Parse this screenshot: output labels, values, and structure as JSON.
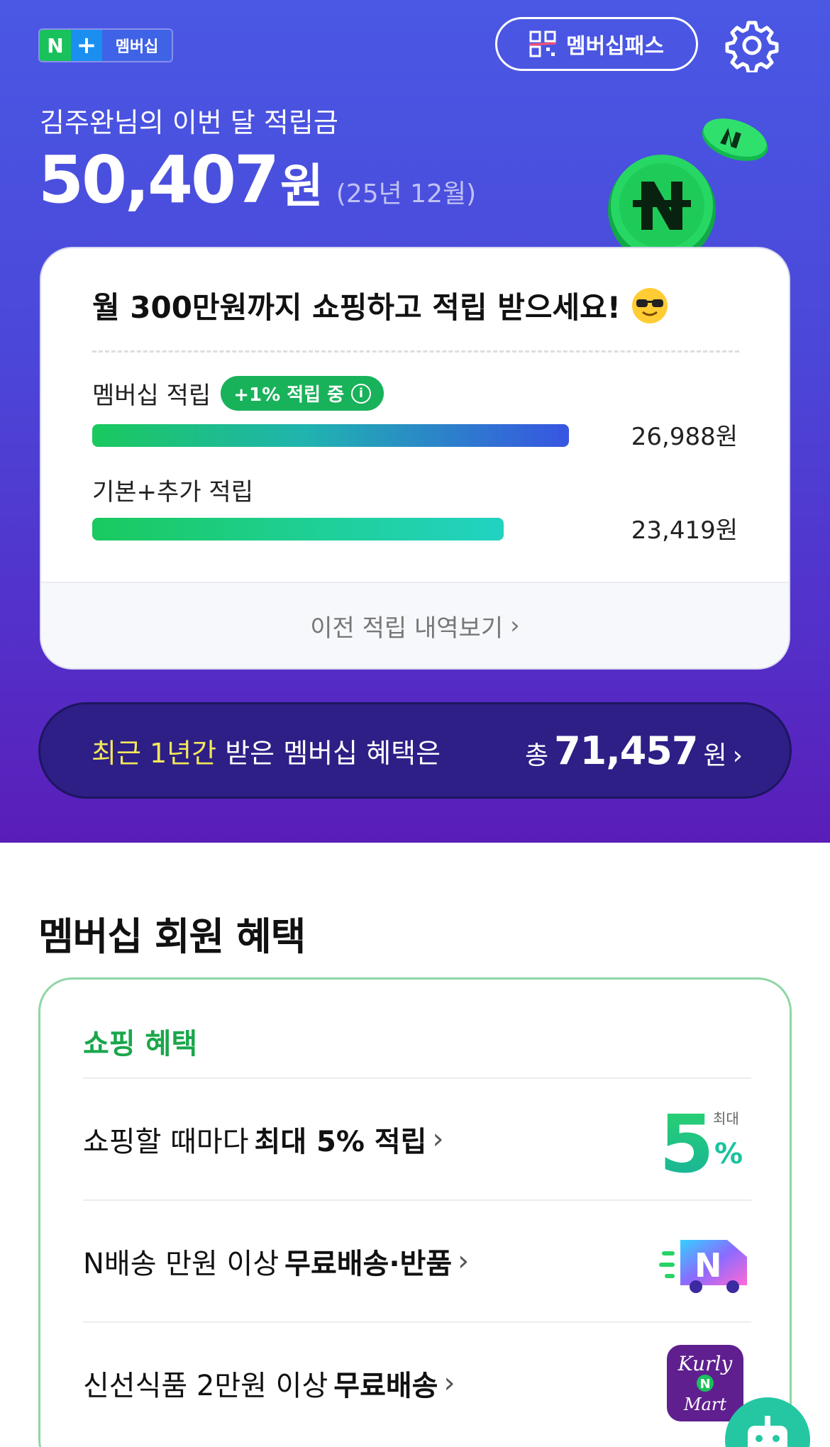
{
  "header": {
    "logo": {
      "n": "N",
      "plus": "+",
      "label": "멤버십"
    },
    "pass_button_label": "멤버십패스"
  },
  "earnings": {
    "title": "김주완님의 이번 달 적립금",
    "amount": "50,407",
    "unit": "원",
    "period": "(25년 12월)"
  },
  "card": {
    "headline": "월 300만원까지 쇼핑하고 적립 받으세요!",
    "membership_label": "멤버십 적립",
    "membership_badge": "+1% 적립 중",
    "membership_badge_info": "i",
    "membership_value": "26,988원",
    "membership_fraction": 0.8,
    "basic_label": "기본+추가 적립",
    "basic_value": "23,419원",
    "basic_fraction": 0.69,
    "history_link": "이전 적립 내역보기",
    "history_chevron": "›"
  },
  "summary": {
    "highlight": "최근 1년간",
    "rest": " 받은 멤버십 혜택은",
    "total_prefix": "총",
    "total_value": "71,457",
    "total_unit": "원",
    "chevron": "›"
  },
  "benefits": {
    "section_title": "멤버십 회원 혜택",
    "category": "쇼핑 혜택",
    "items": [
      {
        "prefix": "쇼핑할 때마다 ",
        "bold": "최대 5% 적립",
        "chevron": "›",
        "icon": "five-percent-icon",
        "icon_top": "최대",
        "icon_num": "5",
        "icon_pct": "%"
      },
      {
        "prefix": "N배송 만원 이상 ",
        "bold": "무료배송·반품",
        "chevron": "›",
        "icon": "delivery-truck-icon",
        "icon_letter": "N"
      },
      {
        "prefix": "신선식품 2만원 이상 ",
        "bold": "무료배송",
        "chevron": "›",
        "icon": "kurly-mart-icon",
        "icon_top": "Kurly",
        "icon_mid": "N",
        "icon_bottom": "Mart"
      }
    ]
  },
  "colors": {
    "hero_top": "#4a58e4",
    "hero_bottom": "#5a1db8",
    "accent_green": "#18b25a",
    "highlight_yellow": "#f3e85a"
  }
}
